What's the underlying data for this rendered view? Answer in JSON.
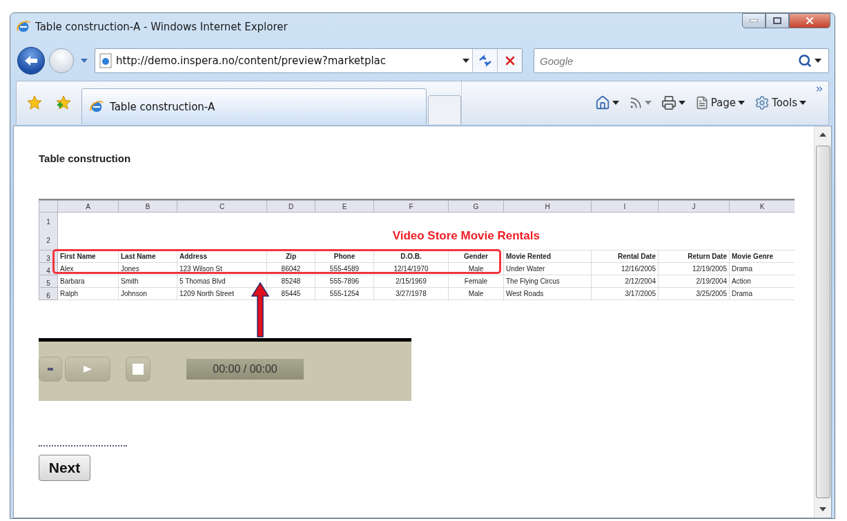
{
  "window": {
    "title": "Table construction-A  - Windows Internet Explorer"
  },
  "address_bar": {
    "url": "http://demo.inspera.no/content/preview?marketplac"
  },
  "search": {
    "placeholder": "Google"
  },
  "tabs": [
    {
      "label": "Table construction-A",
      "selected": true
    }
  ],
  "command_bar": [
    {
      "kind": "home"
    },
    {
      "kind": "feed"
    },
    {
      "kind": "print"
    },
    {
      "kind": "page",
      "label": "Page"
    },
    {
      "kind": "tools",
      "label": "Tools"
    }
  ],
  "page": {
    "heading": "Table construction",
    "spreadsheet": {
      "column_letters": [
        "A",
        "B",
        "C",
        "D",
        "E",
        "F",
        "G",
        "H",
        "I",
        "J",
        "K"
      ],
      "title_row_numbers": [
        "1",
        "2"
      ],
      "title": "Video Store Movie Rentals",
      "header_row": {
        "number": "3",
        "cells": [
          "First Name",
          "Last Name",
          "Address",
          "Zip",
          "Phone",
          "D.O.B.",
          "Gender",
          "Movie Rented",
          "Rental Date",
          "Return Date",
          "Movie Genre"
        ]
      },
      "rows": [
        {
          "number": "4",
          "cells": [
            "Alex",
            "Jones",
            "123 Wilson St",
            "86042",
            "555-4589",
            "12/14/1970",
            "Male",
            "Under Water",
            "12/16/2005",
            "12/19/2005",
            "Drama"
          ]
        },
        {
          "number": "5",
          "cells": [
            "Barbara",
            "Smith",
            "5 Thomas Blvd",
            "85248",
            "555-7896",
            "2/15/1969",
            "Female",
            "The Flying Circus",
            "2/12/2004",
            "2/19/2004",
            "Action"
          ]
        },
        {
          "number": "6",
          "cells": [
            "Ralph",
            "Johnson",
            "1209 North Street",
            "85445",
            "555-1254",
            "3/27/1978",
            "Male",
            "West Roads",
            "3/17/2005",
            "3/25/2005",
            "Drama"
          ]
        }
      ]
    },
    "player": {
      "time": "00:00 / 00:00"
    },
    "next_button": "Next"
  }
}
